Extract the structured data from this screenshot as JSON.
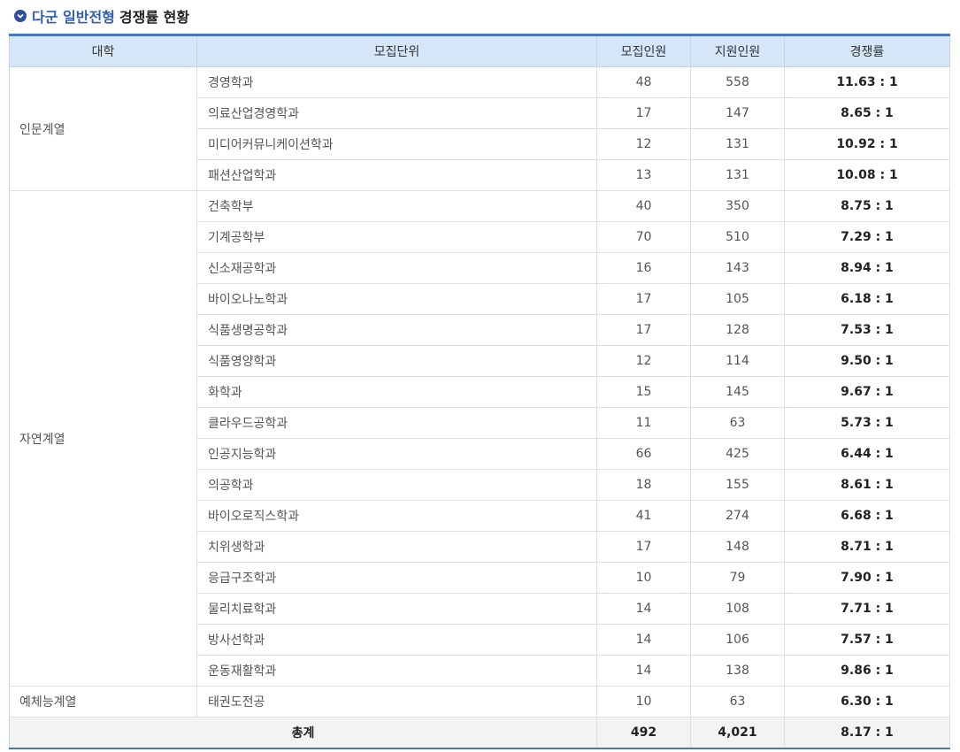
{
  "title": {
    "highlight": "다군 일반전형",
    "rest": "경쟁률 현황"
  },
  "table": {
    "headers": [
      "대학",
      "모집단위",
      "모집인원",
      "지원인원",
      "경쟁률"
    ],
    "groups": [
      {
        "name": "인문계열",
        "rows": [
          {
            "unit": "경영학과",
            "quota": "48",
            "applicants": "558",
            "rate": "11.63 : 1"
          },
          {
            "unit": "의료산업경영학과",
            "quota": "17",
            "applicants": "147",
            "rate": "8.65 : 1"
          },
          {
            "unit": "미디어커뮤니케이션학과",
            "quota": "12",
            "applicants": "131",
            "rate": "10.92 : 1"
          },
          {
            "unit": "패션산업학과",
            "quota": "13",
            "applicants": "131",
            "rate": "10.08 : 1"
          }
        ]
      },
      {
        "name": "자연계열",
        "rows": [
          {
            "unit": "건축학부",
            "quota": "40",
            "applicants": "350",
            "rate": "8.75 : 1"
          },
          {
            "unit": "기계공학부",
            "quota": "70",
            "applicants": "510",
            "rate": "7.29 : 1"
          },
          {
            "unit": "신소재공학과",
            "quota": "16",
            "applicants": "143",
            "rate": "8.94 : 1"
          },
          {
            "unit": "바이오나노학과",
            "quota": "17",
            "applicants": "105",
            "rate": "6.18 : 1"
          },
          {
            "unit": "식품생명공학과",
            "quota": "17",
            "applicants": "128",
            "rate": "7.53 : 1"
          },
          {
            "unit": "식품영양학과",
            "quota": "12",
            "applicants": "114",
            "rate": "9.50 : 1"
          },
          {
            "unit": "화학과",
            "quota": "15",
            "applicants": "145",
            "rate": "9.67 : 1"
          },
          {
            "unit": "클라우드공학과",
            "quota": "11",
            "applicants": "63",
            "rate": "5.73 : 1"
          },
          {
            "unit": "인공지능학과",
            "quota": "66",
            "applicants": "425",
            "rate": "6.44 : 1"
          },
          {
            "unit": "의공학과",
            "quota": "18",
            "applicants": "155",
            "rate": "8.61 : 1"
          },
          {
            "unit": "바이오로직스학과",
            "quota": "41",
            "applicants": "274",
            "rate": "6.68 : 1"
          },
          {
            "unit": "치위생학과",
            "quota": "17",
            "applicants": "148",
            "rate": "8.71 : 1"
          },
          {
            "unit": "응급구조학과",
            "quota": "10",
            "applicants": "79",
            "rate": "7.90 : 1"
          },
          {
            "unit": "물리치료학과",
            "quota": "14",
            "applicants": "108",
            "rate": "7.71 : 1"
          },
          {
            "unit": "방사선학과",
            "quota": "14",
            "applicants": "106",
            "rate": "7.57 : 1"
          },
          {
            "unit": "운동재활학과",
            "quota": "14",
            "applicants": "138",
            "rate": "9.86 : 1"
          }
        ]
      },
      {
        "name": "예체능계열",
        "rows": [
          {
            "unit": "태권도전공",
            "quota": "10",
            "applicants": "63",
            "rate": "6.30 : 1"
          }
        ]
      }
    ],
    "total": {
      "label": "총계",
      "quota": "492",
      "applicants": "4,021",
      "rate": "8.17 : 1"
    }
  },
  "colors": {
    "accent": "#2f5fb3",
    "header_bg": "#d6e6f9",
    "border_top": "#4a78bf"
  },
  "icons": {
    "title_icon": "check-circle-icon"
  }
}
